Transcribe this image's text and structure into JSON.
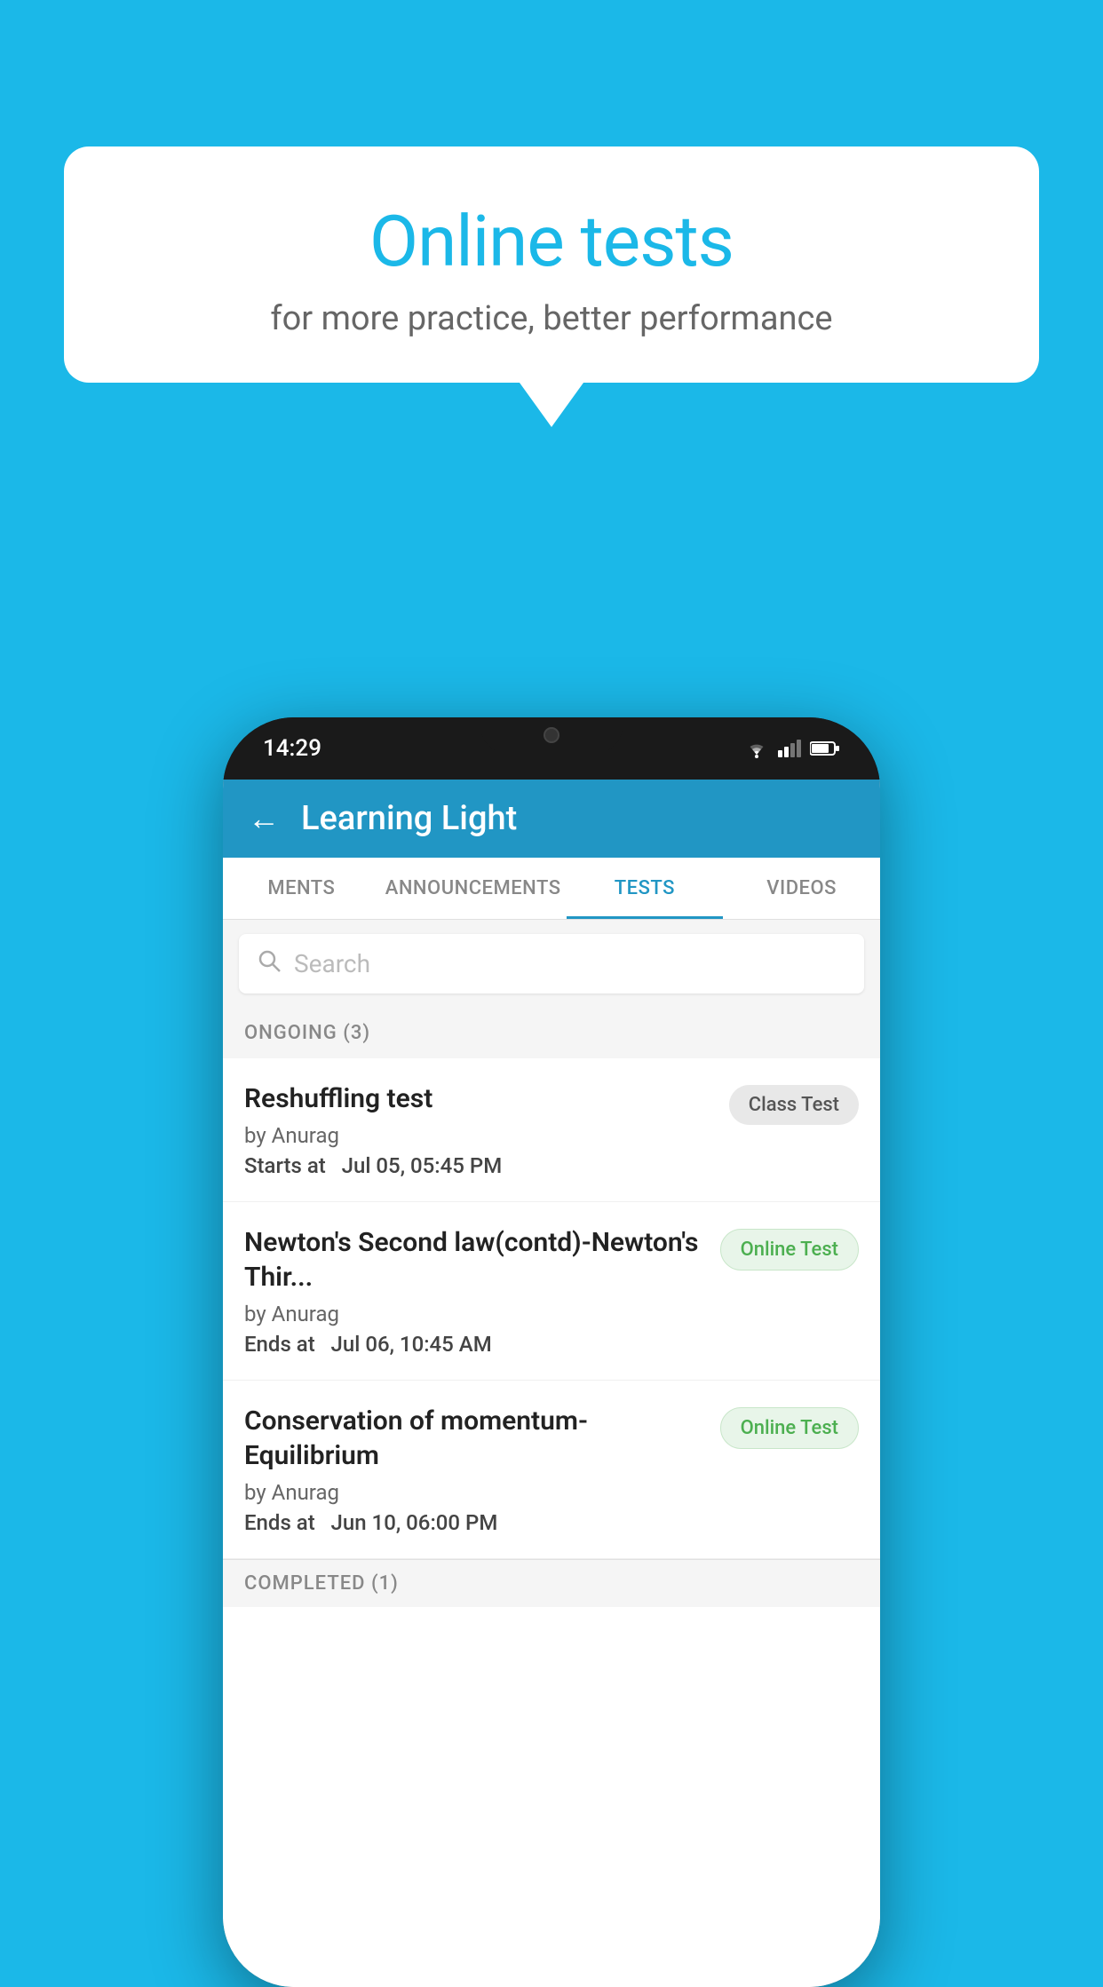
{
  "background_color": "#1bb8e8",
  "speech_bubble": {
    "title": "Online tests",
    "subtitle": "for more practice, better performance"
  },
  "phone": {
    "status_bar": {
      "time": "14:29"
    },
    "app_header": {
      "title": "Learning Light",
      "back_label": "←"
    },
    "tabs": [
      {
        "label": "MENTS",
        "active": false
      },
      {
        "label": "ANNOUNCEMENTS",
        "active": false
      },
      {
        "label": "TESTS",
        "active": true
      },
      {
        "label": "VIDEOS",
        "active": false
      }
    ],
    "search": {
      "placeholder": "Search"
    },
    "ongoing_section": {
      "label": "ONGOING (3)"
    },
    "test_items": [
      {
        "name": "Reshuffling test",
        "by": "by Anurag",
        "time_label": "Starts at",
        "time_value": "Jul 05, 05:45 PM",
        "badge": "Class Test",
        "badge_type": "class"
      },
      {
        "name": "Newton's Second law(contd)-Newton's Thir...",
        "by": "by Anurag",
        "time_label": "Ends at",
        "time_value": "Jul 06, 10:45 AM",
        "badge": "Online Test",
        "badge_type": "online"
      },
      {
        "name": "Conservation of momentum-Equilibrium",
        "by": "by Anurag",
        "time_label": "Ends at",
        "time_value": "Jun 10, 06:00 PM",
        "badge": "Online Test",
        "badge_type": "online"
      }
    ],
    "completed_section": {
      "label": "COMPLETED (1)"
    }
  }
}
